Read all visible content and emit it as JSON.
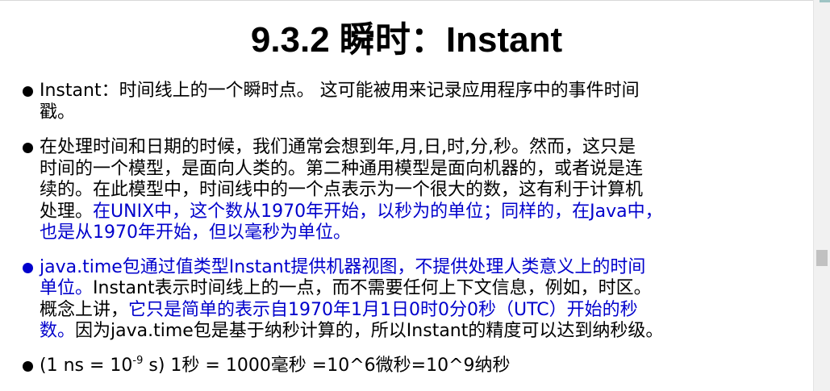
{
  "title": "9.3.2 瞬时：Instant",
  "bullets": [
    {
      "seg1": "Instant：时间线上的一个瞬时点。 这可能被用来记录应用程序中的事件时间",
      "seg2": "戳。"
    },
    {
      "seg1": "在处理时间和日期的时候，我们通常会想到年,月,日,时,分,秒。然而，这只是",
      "seg2": "时间的一个模型，是面向人类的。第二种通用模型是面向机器的，或者说是连",
      "seg3": "续的。在此模型中，时间线中的一个点表示为一个很大的数，这有利于计算机",
      "seg4": "处理。",
      "blue1": "在UNIX中，这个数从1970年开始，以秒为的单位；同样的，在Java中，",
      "blue2": "也是从1970年开始，但以毫秒为单位。"
    },
    {
      "blue1": "java.time包通过值类型Instant提供机器视图，不提供处理人类意义上的时间",
      "blue2": "单位。",
      "seg1": "Instant表示时间线上的一点，而不需要任何上下文信息，例如，时区。",
      "seg2": "概念上讲，",
      "blue3": "它只是简单的表示自1970年1月1日0时0分0秒（UTC）开始的秒",
      "blue4": "数。",
      "seg3": "因为java.time包是基于纳秒计算的，所以Instant的精度可以达到纳秒级。"
    },
    {
      "pre": "(1 ns = 10",
      "exp": "-9",
      "post": " s)   1秒 = 1000毫秒 =10^6微秒=10^9纳秒"
    }
  ],
  "colors": {
    "text": "#000000",
    "highlight": "#0000cc",
    "background": "#ffffff"
  }
}
